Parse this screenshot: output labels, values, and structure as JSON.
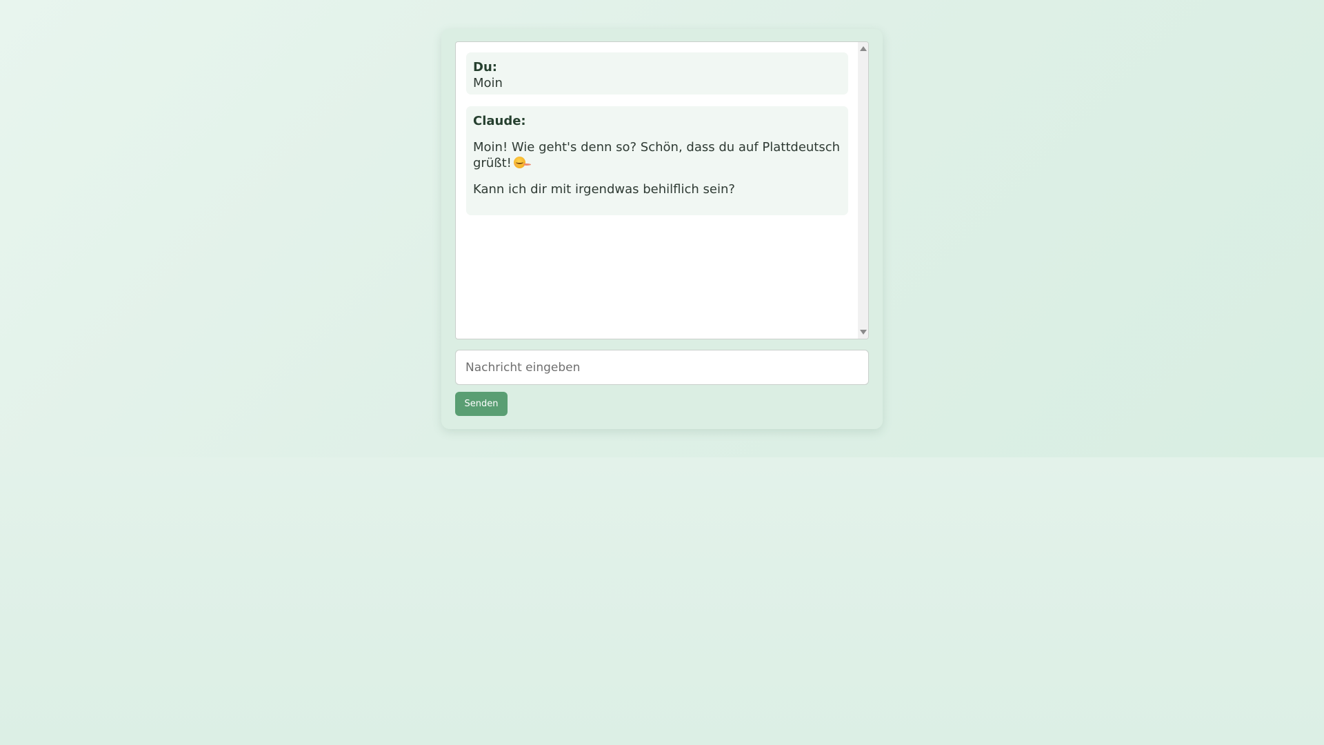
{
  "chat": {
    "messages": [
      {
        "sender": "Du:",
        "lines": [
          "Moin"
        ]
      },
      {
        "sender": "Claude:",
        "paragraphs": [
          "Moin! Wie geht's denn so? Schön, dass du auf Plattdeutsch grüßt!",
          "Kann ich dir mit irgendwas behilflich sein?"
        ],
        "emoji": "smiling-face-icon"
      }
    ]
  },
  "input": {
    "placeholder": "Nachricht eingeben",
    "value": ""
  },
  "send_button": {
    "label": "Senden"
  },
  "colors": {
    "accent": "#5a9e73",
    "background": "#dcefe4",
    "message_bg": "#f1f7f3"
  }
}
